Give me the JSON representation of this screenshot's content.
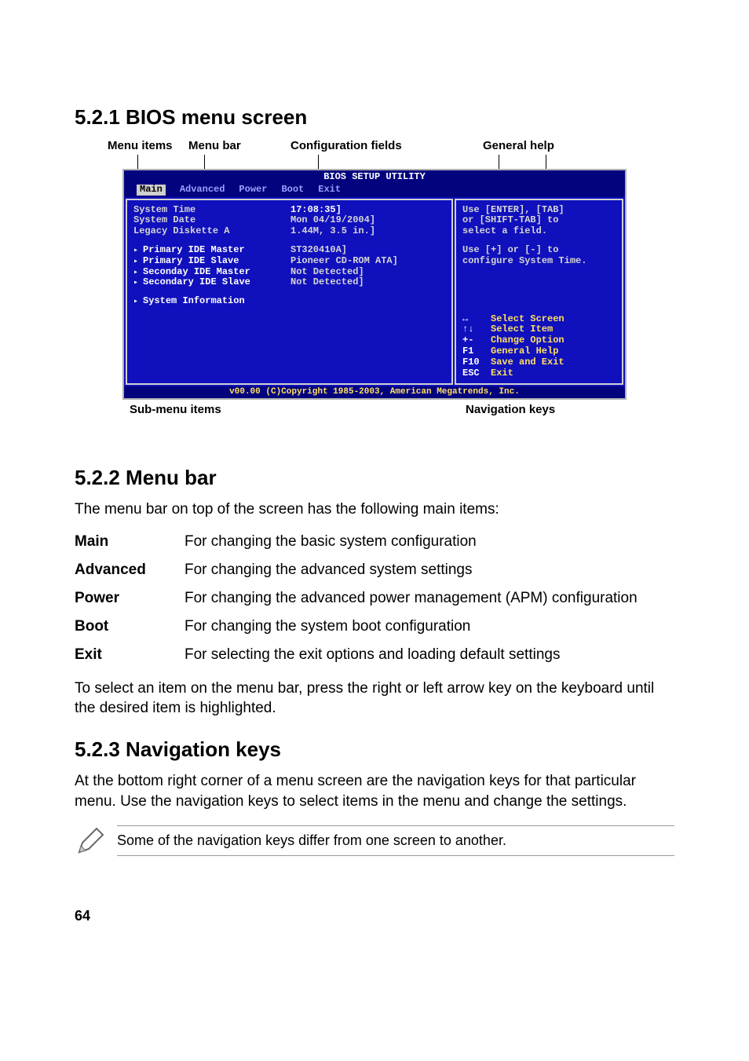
{
  "section1_title": "5.2.1  BIOS menu screen",
  "labels": {
    "menu_items": "Menu items",
    "menu_bar": "Menu bar",
    "config_fields": "Configuration fields",
    "general_help": "General help",
    "sub_menu": "Sub-menu items",
    "nav_keys": "Navigation keys"
  },
  "bios": {
    "title": "BIOS SETUP UTILITY",
    "tabs": {
      "main": "Main",
      "advanced": "Advanced",
      "power": "Power",
      "boot": "Boot",
      "exit": "Exit"
    },
    "left_items": {
      "sys_time": "System Time",
      "sys_date": "System Date",
      "legacy": "Legacy Diskette A",
      "pim": "Primary IDE Master",
      "pis": "Primary IDE Slave",
      "sem": "Seconday IDE Master",
      "ses": "Secondary IDE Slave",
      "sysinfo": "System Information"
    },
    "values": {
      "time": "17:08:35]",
      "date": "Mon 04/19/2004]",
      "disk": "1.44M, 3.5 in.]",
      "pim": "ST320410A]",
      "pis": "Pioneer CD-ROM ATA]",
      "sem": "Not Detected]",
      "ses": "Not Detected]"
    },
    "help": {
      "l1": "Use [ENTER], [TAB]",
      "l2": "or [SHIFT-TAB] to",
      "l3": "select a field.",
      "l4": "Use [+] or [-] to",
      "l5": "configure System Time."
    },
    "nav": {
      "select_screen": "Select Screen",
      "select_item": "Select Item",
      "change_option": "Change Option",
      "general_help": "General Help",
      "save_exit": "Save and Exit",
      "exit": "Exit",
      "k_lr": "↔",
      "k_ud": "↑↓",
      "k_pm": "+-",
      "k_f1": "F1",
      "k_f10": "F10",
      "k_esc": "ESC"
    },
    "footer": "v00.00 (C)Copyright 1985-2003, American Megatrends, Inc."
  },
  "section2_title": "5.2.2  Menu bar",
  "section2_intro": "The menu bar on top of the screen has the following main items:",
  "defs": {
    "main_t": "Main",
    "main_d": "For changing the basic system configuration",
    "adv_t": "Advanced",
    "adv_d": "For changing the advanced system settings",
    "pow_t": "Power",
    "pow_d": "For changing the advanced power management (APM) configuration",
    "boot_t": "Boot",
    "boot_d": "For changing the system boot configuration",
    "exit_t": "Exit",
    "exit_d": "For selecting the exit options and loading default settings"
  },
  "section2_outro": "To select an item on the menu bar, press the right or left arrow key on the keyboard until the desired item is highlighted.",
  "section3_title": "5.2.3  Navigation keys",
  "section3_body": "At the bottom right corner of a menu screen are the navigation keys for that particular menu. Use the navigation keys to select items in the menu and change the settings.",
  "note": "Some of the navigation keys differ from one screen to another.",
  "page_number": "64"
}
